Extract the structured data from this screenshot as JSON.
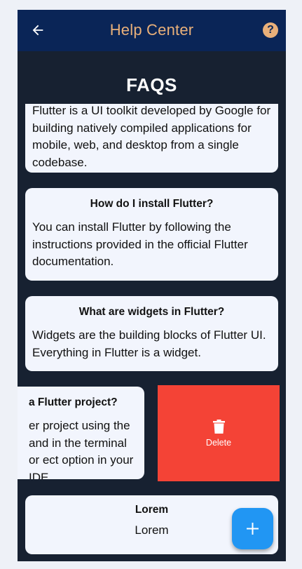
{
  "appbar": {
    "title": "Help Center",
    "back_icon": "arrow-left-icon",
    "help_icon": "question-circle-icon",
    "help_glyph": "?"
  },
  "page": {
    "title": "FAQS"
  },
  "faqs": [
    {
      "question": "",
      "answer": "Flutter is a UI toolkit developed by Google for building natively compiled applications for mobile, web, and desktop from a single codebase."
    },
    {
      "question": "How do I install Flutter?",
      "answer": "You can install Flutter by following the instructions provided in the official Flutter documentation."
    },
    {
      "question": "What are widgets in Flutter?",
      "answer": "Widgets are the building blocks of Flutter UI. Everything in Flutter is a widget."
    },
    {
      "question": "a Flutter project?",
      "answer": "er project using the and in the terminal or ect option in your IDE."
    },
    {
      "question": "Lorem",
      "answer": "Lorem"
    }
  ],
  "swipe_action": {
    "label": "Delete",
    "icon": "trash-icon",
    "color": "#f44336"
  },
  "fab": {
    "icon": "plus-icon",
    "color": "#2196f3"
  },
  "colors": {
    "appbar": "#0a2557",
    "accent": "#e9b07a",
    "background": "#172131",
    "card": "#f2f5fd"
  }
}
